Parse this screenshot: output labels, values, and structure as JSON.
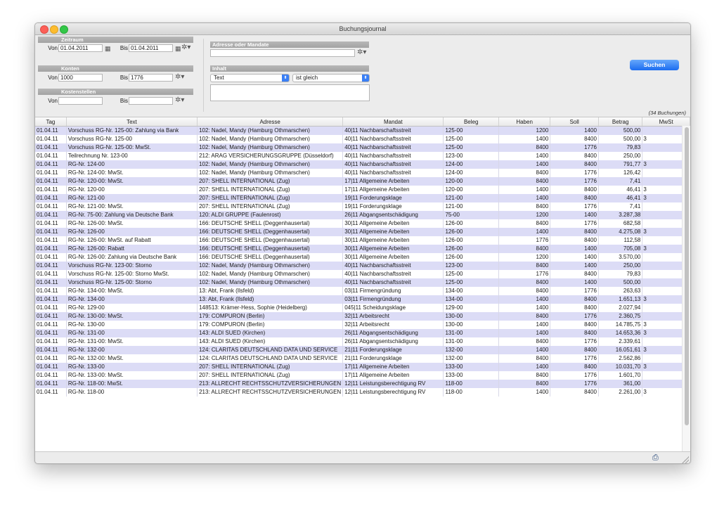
{
  "window": {
    "title": "Buchungsjournal"
  },
  "filters": {
    "zeitraum": {
      "header": "Zeitraum",
      "von_label": "Von",
      "von": "01.04.2011",
      "bis_label": "Bis",
      "bis": "01.04.2011"
    },
    "konten": {
      "header": "Konten",
      "von_label": "Von",
      "von": "1000",
      "bis_label": "Bis",
      "bis": "1776"
    },
    "kostenstellen": {
      "header": "Kostenstellen",
      "von_label": "Von",
      "von": "",
      "bis_label": "Bis",
      "bis": ""
    },
    "adresse": {
      "header": "Adresse oder Mandate",
      "value": ""
    },
    "inhalt": {
      "header": "Inhalt",
      "field": "Text",
      "operator": "ist gleich",
      "value": ""
    }
  },
  "search_label": "Suchen",
  "count_label": "(34 Buchungen)",
  "columns": [
    "Tag",
    "Text",
    "Adresse",
    "Mandat",
    "Beleg",
    "Haben",
    "Soll",
    "Betrag",
    "MwSt"
  ],
  "rows": [
    [
      "01.04.11",
      "Vorschuss RG-Nr. 125-00: Zahlung via Bank",
      "102: Nadel, Mandy (Hamburg Othmarschen)",
      "40|11 Nachbarschaftsstreit",
      "125-00",
      "1200",
      "1400",
      "500,00",
      ""
    ],
    [
      "01.04.11",
      "Vorschuss RG-Nr. 125-00",
      "102: Nadel, Mandy (Hamburg Othmarschen)",
      "40|11 Nachbarschaftsstreit",
      "125-00",
      "1400",
      "8400",
      "500,00",
      "3"
    ],
    [
      "01.04.11",
      "Vorschuss RG-Nr. 125-00: MwSt.",
      "102: Nadel, Mandy (Hamburg Othmarschen)",
      "40|11 Nachbarschaftsstreit",
      "125-00",
      "8400",
      "1776",
      "79,83",
      ""
    ],
    [
      "01.04.11",
      "Teilrechnung Nr. 123-00",
      "212: ARAG VERSICHERUNGSGRUPPE (Düsseldorf)",
      "40|11 Nachbarschaftsstreit",
      "123-00",
      "1400",
      "8400",
      "250,00",
      ""
    ],
    [
      "01.04.11",
      "RG-Nr. 124-00",
      "102: Nadel, Mandy (Hamburg Othmarschen)",
      "40|11 Nachbarschaftsstreit",
      "124-00",
      "1400",
      "8400",
      "791,77",
      "3"
    ],
    [
      "01.04.11",
      "RG-Nr. 124-00: MwSt.",
      "102: Nadel, Mandy (Hamburg Othmarschen)",
      "40|11 Nachbarschaftsstreit",
      "124-00",
      "8400",
      "1776",
      "126,42",
      ""
    ],
    [
      "01.04.11",
      "RG-Nr. 120-00: MwSt.",
      "207: SHELL INTERNATIONAL (Zug)",
      "17|11 Allgemeine Arbeiten",
      "120-00",
      "8400",
      "1776",
      "7,41",
      ""
    ],
    [
      "01.04.11",
      "RG-Nr. 120-00",
      "207: SHELL INTERNATIONAL (Zug)",
      "17|11 Allgemeine Arbeiten",
      "120-00",
      "1400",
      "8400",
      "46,41",
      "3"
    ],
    [
      "01.04.11",
      "RG-Nr. 121-00",
      "207: SHELL INTERNATIONAL (Zug)",
      "19|11 Forderungsklage",
      "121-00",
      "1400",
      "8400",
      "46,41",
      "3"
    ],
    [
      "01.04.11",
      "RG-Nr. 121-00: MwSt.",
      "207: SHELL INTERNATIONAL (Zug)",
      "19|11 Forderungsklage",
      "121-00",
      "8400",
      "1776",
      "7,41",
      ""
    ],
    [
      "01.04.11",
      "RG-Nr. 75-00: Zahlung via Deutsche Bank",
      "120: ALDI GRUPPE (Faulenrost)",
      "26|11 Abgangsentschädigung",
      "75-00",
      "1200",
      "1400",
      "3.287,38",
      ""
    ],
    [
      "01.04.11",
      "RG-Nr. 126-00: MwSt.",
      "166: DEUTSCHE SHELL (Deggenhausertal)",
      "30|11 Allgemeine Arbeiten",
      "126-00",
      "8400",
      "1776",
      "682,58",
      ""
    ],
    [
      "01.04.11",
      "RG-Nr. 126-00",
      "166: DEUTSCHE SHELL (Deggenhausertal)",
      "30|11 Allgemeine Arbeiten",
      "126-00",
      "1400",
      "8400",
      "4.275,08",
      "3"
    ],
    [
      "01.04.11",
      "RG-Nr. 126-00: MwSt. auf Rabatt",
      "166: DEUTSCHE SHELL (Deggenhausertal)",
      "30|11 Allgemeine Arbeiten",
      "126-00",
      "1776",
      "8400",
      "112,58",
      ""
    ],
    [
      "01.04.11",
      "RG-Nr. 126-00: Rabatt",
      "166: DEUTSCHE SHELL (Deggenhausertal)",
      "30|11 Allgemeine Arbeiten",
      "126-00",
      "8400",
      "1400",
      "705,08",
      "3"
    ],
    [
      "01.04.11",
      "RG-Nr. 126-00: Zahlung via Deutsche Bank",
      "166: DEUTSCHE SHELL (Deggenhausertal)",
      "30|11 Allgemeine Arbeiten",
      "126-00",
      "1200",
      "1400",
      "3.570,00",
      ""
    ],
    [
      "01.04.11",
      "Vorschuss RG-Nr. 123-00: Storno",
      "102: Nadel, Mandy (Hamburg Othmarschen)",
      "40|11 Nachbarschaftsstreit",
      "123-00",
      "8400",
      "1400",
      "250,00",
      ""
    ],
    [
      "01.04.11",
      "Vorschuss RG-Nr. 125-00: Storno MwSt.",
      "102: Nadel, Mandy (Hamburg Othmarschen)",
      "40|11 Nachbarschaftsstreit",
      "125-00",
      "1776",
      "8400",
      "79,83",
      ""
    ],
    [
      "01.04.11",
      "Vorschuss RG-Nr. 125-00: Storno",
      "102: Nadel, Mandy (Hamburg Othmarschen)",
      "40|11 Nachbarschaftsstreit",
      "125-00",
      "8400",
      "1400",
      "500,00",
      ""
    ],
    [
      "01.04.11",
      "RG-Nr. 134-00: MwSt.",
      "13: Abt, Frank (Ilsfeld)",
      "03|11 Firmengründung",
      "134-00",
      "8400",
      "1776",
      "263,63",
      ""
    ],
    [
      "01.04.11",
      "RG-Nr. 134-00",
      "13: Abt, Frank (Ilsfeld)",
      "03|11 Firmengründung",
      "134-00",
      "1400",
      "8400",
      "1.651,13",
      "3"
    ],
    [
      "01.04.11",
      "RG-Nr. 129-00",
      "148513: Krämer-Hess, Sophie (Heidelberg)",
      "045|11 Scheidungsklage",
      "129-00",
      "1400",
      "8400",
      "2.027,94",
      ""
    ],
    [
      "01.04.11",
      "RG-Nr. 130-00: MwSt.",
      "179: COMPURON (Berlin)",
      "32|11 Arbeitsrecht",
      "130-00",
      "8400",
      "1776",
      "2.360,75",
      ""
    ],
    [
      "01.04.11",
      "RG-Nr. 130-00",
      "179: COMPURON (Berlin)",
      "32|11 Arbeitsrecht",
      "130-00",
      "1400",
      "8400",
      "14.785,75",
      "3"
    ],
    [
      "01.04.11",
      "RG-Nr. 131-00",
      "143: ALDI SUED (Kirchen)",
      "26|11 Abgangsentschädigung",
      "131-00",
      "1400",
      "8400",
      "14.653,36",
      "3"
    ],
    [
      "01.04.11",
      "RG-Nr. 131-00: MwSt.",
      "143: ALDI SUED (Kirchen)",
      "26|11 Abgangsentschädigung",
      "131-00",
      "8400",
      "1776",
      "2.339,61",
      ""
    ],
    [
      "01.04.11",
      "RG-Nr. 132-00",
      "124: CLARITAS DEUTSCHLAND DATA UND SERVICE",
      "21|11 Forderungsklage",
      "132-00",
      "1400",
      "8400",
      "16.051,61",
      "3"
    ],
    [
      "01.04.11",
      "RG-Nr. 132-00: MwSt.",
      "124: CLARITAS DEUTSCHLAND DATA UND SERVICE",
      "21|11 Forderungsklage",
      "132-00",
      "8400",
      "1776",
      "2.562,86",
      ""
    ],
    [
      "01.04.11",
      "RG-Nr. 133-00",
      "207: SHELL INTERNATIONAL (Zug)",
      "17|11 Allgemeine Arbeiten",
      "133-00",
      "1400",
      "8400",
      "10.031,70",
      "3"
    ],
    [
      "01.04.11",
      "RG-Nr. 133-00: MwSt.",
      "207: SHELL INTERNATIONAL (Zug)",
      "17|11 Allgemeine Arbeiten",
      "133-00",
      "8400",
      "1776",
      "1.601,70",
      ""
    ],
    [
      "01.04.11",
      "RG-Nr. 118-00: MwSt.",
      "213: ALLRECHT RECHTSSCHUTZVERSICHERUNGEN",
      "12|11 Leistungsberechtigung RV",
      "118-00",
      "8400",
      "1776",
      "361,00",
      ""
    ],
    [
      "01.04.11",
      "RG-Nr. 118-00",
      "213: ALLRECHT RECHTSSCHUTZVERSICHERUNGEN",
      "12|11 Leistungsberechtigung RV",
      "118-00",
      "1400",
      "8400",
      "2.261,00",
      "3"
    ]
  ],
  "icons": {
    "calendar": "calendar-icon",
    "gear": "gear-icon",
    "printer": "printer-icon"
  }
}
